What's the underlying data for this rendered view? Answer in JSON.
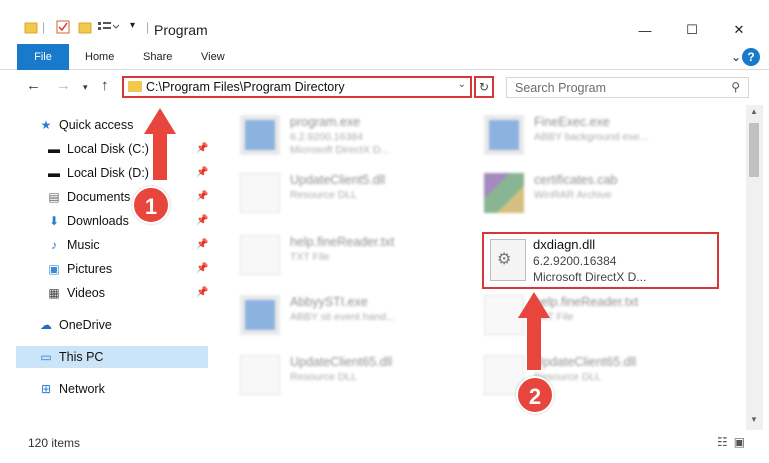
{
  "window": {
    "title": "Program",
    "minimize": "—",
    "maximize": "☐",
    "close": "✕"
  },
  "ribbon": {
    "tabs": [
      "File",
      "Home",
      "Share",
      "View"
    ],
    "help": "?",
    "expand": "⌄"
  },
  "nav": {
    "address": "C:\\Program Files\\Program Directory",
    "search_placeholder": "Search Program"
  },
  "sidebar": {
    "items": [
      {
        "label": "Quick access",
        "icon": "star-icon",
        "pinned": false
      },
      {
        "label": "Local Disk (C:)",
        "icon": "drive-icon",
        "pinned": true
      },
      {
        "label": "Local Disk (D:)",
        "icon": "drive-icon",
        "pinned": true
      },
      {
        "label": "Documents",
        "icon": "documents-icon",
        "pinned": true
      },
      {
        "label": "Downloads",
        "icon": "download-icon",
        "pinned": true
      },
      {
        "label": "Music",
        "icon": "music-icon",
        "pinned": true
      },
      {
        "label": "Pictures",
        "icon": "pictures-icon",
        "pinned": true
      },
      {
        "label": "Videos",
        "icon": "videos-icon",
        "pinned": true
      },
      {
        "label": "OneDrive",
        "icon": "cloud-icon",
        "pinned": false
      },
      {
        "label": "This PC",
        "icon": "computer-icon",
        "pinned": false,
        "selected": true
      },
      {
        "label": "Network",
        "icon": "network-icon",
        "pinned": false
      }
    ]
  },
  "files": [
    {
      "name": "program.exe",
      "line1": "6.2.9200.16384",
      "line2": "Microsoft DirectX D...",
      "icon": "exe-icon"
    },
    {
      "name": "FineExec.exe",
      "line1": "ABBY background exe...",
      "line2": "",
      "icon": "exe-icon"
    },
    {
      "name": "UpdateClient5.dll",
      "line1": "Resource DLL",
      "line2": "",
      "icon": "dll-icon"
    },
    {
      "name": "certificates.cab",
      "line1": "WinRAR Archive",
      "line2": "",
      "icon": "archive-icon"
    },
    {
      "name": "help.fineReader.txt",
      "line1": "TXT File",
      "line2": "",
      "icon": "txt-icon"
    },
    {
      "name": "dxdiagn.dll",
      "line1": "6.2.9200.16384",
      "line2": "Microsoft DirectX D...",
      "icon": "dll-icon",
      "highlighted": true
    },
    {
      "name": "AbbyySTI.exe",
      "line1": "ABBY sti event hand...",
      "line2": "",
      "icon": "exe-icon"
    },
    {
      "name": "help.fineReader.txt",
      "line1": "TXT File",
      "line2": "",
      "icon": "txt-icon"
    },
    {
      "name": "UpdateClient65.dll",
      "line1": "Resource DLL",
      "line2": "",
      "icon": "dll-icon"
    },
    {
      "name": "UpdateClient65.dll",
      "line1": "Resource DLL",
      "line2": "",
      "icon": "dll-icon"
    }
  ],
  "status": {
    "count": "120 items"
  },
  "annotations": {
    "step1": "1",
    "step2": "2",
    "color": "#e8453c"
  }
}
